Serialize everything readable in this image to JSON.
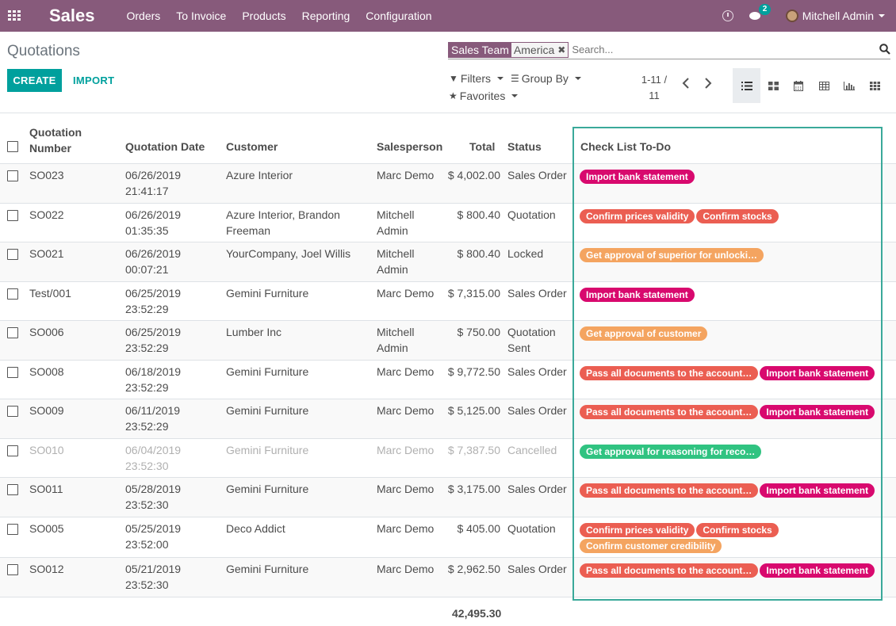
{
  "navbar": {
    "app_name": "Sales",
    "menu": [
      "Orders",
      "To Invoice",
      "Products",
      "Reporting",
      "Configuration"
    ],
    "message_count": "2",
    "user_name": "Mitchell Admin"
  },
  "control_panel": {
    "breadcrumb": "Quotations",
    "create_label": "CREATE",
    "import_label": "IMPORT",
    "facet_label": "Sales Team",
    "facet_value": "America",
    "search_placeholder": "Search...",
    "filters_label": "Filters",
    "groupby_label": "Group By",
    "favorites_label": "Favorites",
    "pager_range": "1-11 /",
    "pager_total": "11",
    "active_view": "list"
  },
  "table": {
    "headers": {
      "number_line1": "Quotation",
      "number_line2": "Number",
      "date": "Quotation Date",
      "customer": "Customer",
      "salesperson": "Salesperson",
      "total": "Total",
      "status": "Status",
      "checklist": "Check List To-Do"
    },
    "rows": [
      {
        "number": "SO023",
        "date": "06/26/2019",
        "time": "21:41:17",
        "customer": "Azure Interior",
        "salesperson": "Marc Demo",
        "total": "$ 4,002.00",
        "status": "Sales Order",
        "tags": [
          {
            "label": "Import bank statement",
            "color": "#d8096e"
          }
        ]
      },
      {
        "number": "SO022",
        "date": "06/26/2019",
        "time": "01:35:35",
        "customer": "Azure Interior, Brandon Freeman",
        "salesperson": "Mitchell Admin",
        "total": "$ 800.40",
        "status": "Quotation",
        "tags": [
          {
            "label": "Confirm prices validity",
            "color": "#eb5e52"
          },
          {
            "label": "Confirm stocks",
            "color": "#eb5e52"
          }
        ]
      },
      {
        "number": "SO021",
        "date": "06/26/2019",
        "time": "00:07:21",
        "customer": "YourCompany, Joel Willis",
        "salesperson": "Mitchell Admin",
        "total": "$ 800.40",
        "status": "Locked",
        "tags": [
          {
            "label": "Get approval of superior for unlocki…",
            "color": "#f4a460"
          }
        ]
      },
      {
        "number": "Test/001",
        "date": "06/25/2019",
        "time": "23:52:29",
        "customer": "Gemini Furniture",
        "salesperson": "Marc Demo",
        "total": "$ 7,315.00",
        "status": "Sales Order",
        "tags": [
          {
            "label": "Import bank statement",
            "color": "#d8096e"
          }
        ]
      },
      {
        "number": "SO006",
        "date": "06/25/2019",
        "time": "23:52:29",
        "customer": "Lumber Inc",
        "salesperson": "Mitchell Admin",
        "total": "$ 750.00",
        "status": "Quotation Sent",
        "tags": [
          {
            "label": "Get approval of customer",
            "color": "#f4a460"
          }
        ]
      },
      {
        "number": "SO008",
        "date": "06/18/2019",
        "time": "23:52:29",
        "customer": "Gemini Furniture",
        "salesperson": "Marc Demo",
        "total": "$ 9,772.50",
        "status": "Sales Order",
        "tags": [
          {
            "label": "Pass all documents to the account…",
            "color": "#eb5e52"
          },
          {
            "label": "Import bank statement",
            "color": "#d8096e"
          }
        ]
      },
      {
        "number": "SO009",
        "date": "06/11/2019",
        "time": "23:52:29",
        "customer": "Gemini Furniture",
        "salesperson": "Marc Demo",
        "total": "$ 5,125.00",
        "status": "Sales Order",
        "tags": [
          {
            "label": "Pass all documents to the account…",
            "color": "#eb5e52"
          },
          {
            "label": "Import bank statement",
            "color": "#d8096e"
          }
        ]
      },
      {
        "number": "SO010",
        "date": "06/04/2019",
        "time": "23:52:30",
        "customer": "Gemini Furniture",
        "salesperson": "Marc Demo",
        "total": "$ 7,387.50",
        "status": "Cancelled",
        "tags": [
          {
            "label": "Get approval for reasoning for reco…",
            "color": "#30c381"
          }
        ]
      },
      {
        "number": "SO011",
        "date": "05/28/2019",
        "time": "23:52:30",
        "customer": "Gemini Furniture",
        "salesperson": "Marc Demo",
        "total": "$ 3,175.00",
        "status": "Sales Order",
        "tags": [
          {
            "label": "Pass all documents to the account…",
            "color": "#eb5e52"
          },
          {
            "label": "Import bank statement",
            "color": "#d8096e"
          }
        ]
      },
      {
        "number": "SO005",
        "date": "05/25/2019",
        "time": "23:52:00",
        "customer": "Deco Addict",
        "salesperson": "Marc Demo",
        "total": "$ 405.00",
        "status": "Quotation",
        "tags": [
          {
            "label": "Confirm prices validity",
            "color": "#eb5e52"
          },
          {
            "label": "Confirm stocks",
            "color": "#eb5e52"
          },
          {
            "label": "Confirm customer credibility",
            "color": "#f4a460"
          }
        ]
      },
      {
        "number": "SO012",
        "date": "05/21/2019",
        "time": "23:52:30",
        "customer": "Gemini Furniture",
        "salesperson": "Marc Demo",
        "total": "$ 2,962.50",
        "status": "Sales Order",
        "tags": [
          {
            "label": "Pass all documents to the account…",
            "color": "#eb5e52"
          },
          {
            "label": "Import bank statement",
            "color": "#d8096e"
          }
        ]
      }
    ],
    "sum_total": "42,495.30"
  },
  "colors": {
    "brand": "#875a7b",
    "accent": "#00a09d",
    "highlight": "#3aa99a"
  }
}
